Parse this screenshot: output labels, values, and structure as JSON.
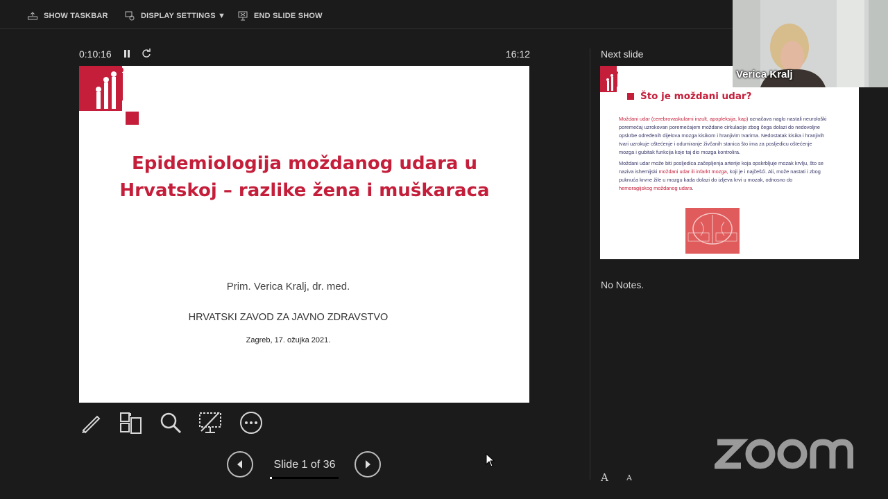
{
  "toolbar": {
    "show_taskbar": "SHOW TASKBAR",
    "display_settings": "DISPLAY SETTINGS ▼",
    "end_slide_show": "END SLIDE SHOW"
  },
  "presenter": {
    "elapsed_time": "0:10:16",
    "clock": "16:12",
    "next_slide_label": "Next slide",
    "notes": "No Notes."
  },
  "current_slide": {
    "title_line1": "Epidemiologija moždanog udara u",
    "title_line2": "Hrvatskoj – razlike žena i muškaraca",
    "author": "Prim. Verica Kralj, dr. med.",
    "institution": "HRVATSKI ZAVOD ZA JAVNO ZDRAVSTVO",
    "date": "Zagreb, 17. ožujka 2021."
  },
  "next_slide": {
    "title": "Što je moždani udar?",
    "p1_red": "Moždani udar (cerebrovaskularni inzult, apopleksija, kap)",
    "p1_text": " označava naglo nastali neurološki poremećaj uzrokovan poremećajem moždane cirkulacije zbog čega dolazi do nedovoljne opskrbe određenih dijelova mozga kisikom i hranjivim tvarima. Nedostatak kisika i hranjivih tvari uzrokuje oštećenje i odumiranje živčanih stanica što ima za posljedicu oštećenje mozga i gubitak funkcija koje taj dio mozga kontrolira.",
    "p2_text_a": "Moždani udar može biti posljedica začepljenja arterije koja opskrbljuje mozak krvlju, što se naziva ishemijski ",
    "p2_red_a": "moždani udar ili infarkt mozga",
    "p2_text_b": ", koji je i najčešći. Ali, može nastati i zbog puknuća krvne žile u mozgu kada dolazi do izljeva krvi u mozak, odnosno do ",
    "p2_red_b": "hemoragijskog moždanog udara",
    "p2_text_c": "."
  },
  "navigation": {
    "slide_counter": "Slide 1 of 36",
    "current": 1,
    "total": 36
  },
  "tools": [
    "pen-icon",
    "see-all-slides-icon",
    "zoom-icon",
    "black-screen-icon",
    "more-options-icon"
  ],
  "notes_font": {
    "increase": "A",
    "decrease": "A"
  },
  "webcam": {
    "participant_name": "Verica Kralj"
  },
  "branding": {
    "logo": "zoom"
  },
  "colors": {
    "slide_red": "#c41e3a",
    "background": "#1b1b1b"
  }
}
